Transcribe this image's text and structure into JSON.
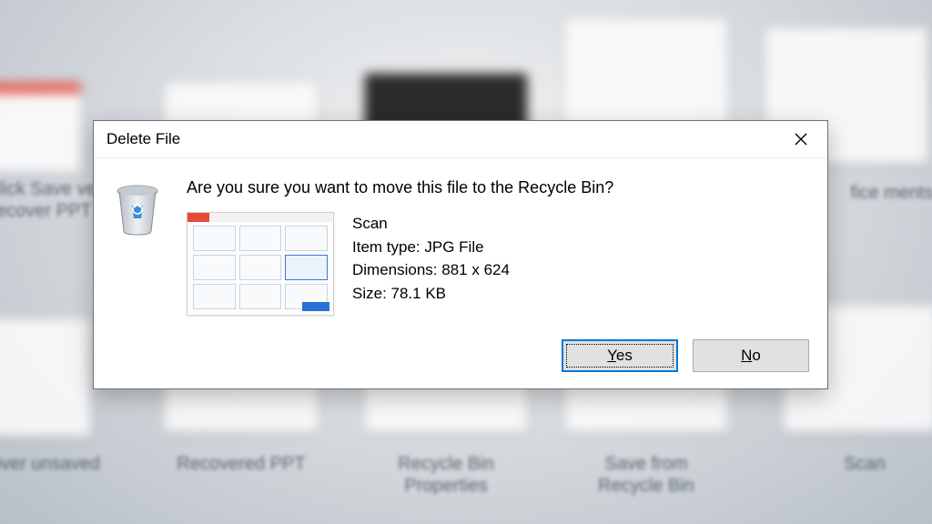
{
  "dialog": {
    "title": "Delete File",
    "prompt": "Are you sure you want to move this file to the Recycle Bin?",
    "file": {
      "name": "Scan",
      "type_label": "Item type: ",
      "type_value": "JPG File",
      "dimensions_label": "Dimensions: ",
      "dimensions_value": "881 x 624",
      "size_label": "Size: ",
      "size_value": "78.1 KB"
    },
    "buttons": {
      "yes": "Yes",
      "no": "No"
    }
  },
  "background": {
    "labels": [
      "Click Save ve recover PPT",
      "Recovered PPT",
      "Recycle Bin Properties",
      "Save from Recycle Bin",
      "Scan",
      "fice ments",
      "cover unsaved"
    ]
  }
}
